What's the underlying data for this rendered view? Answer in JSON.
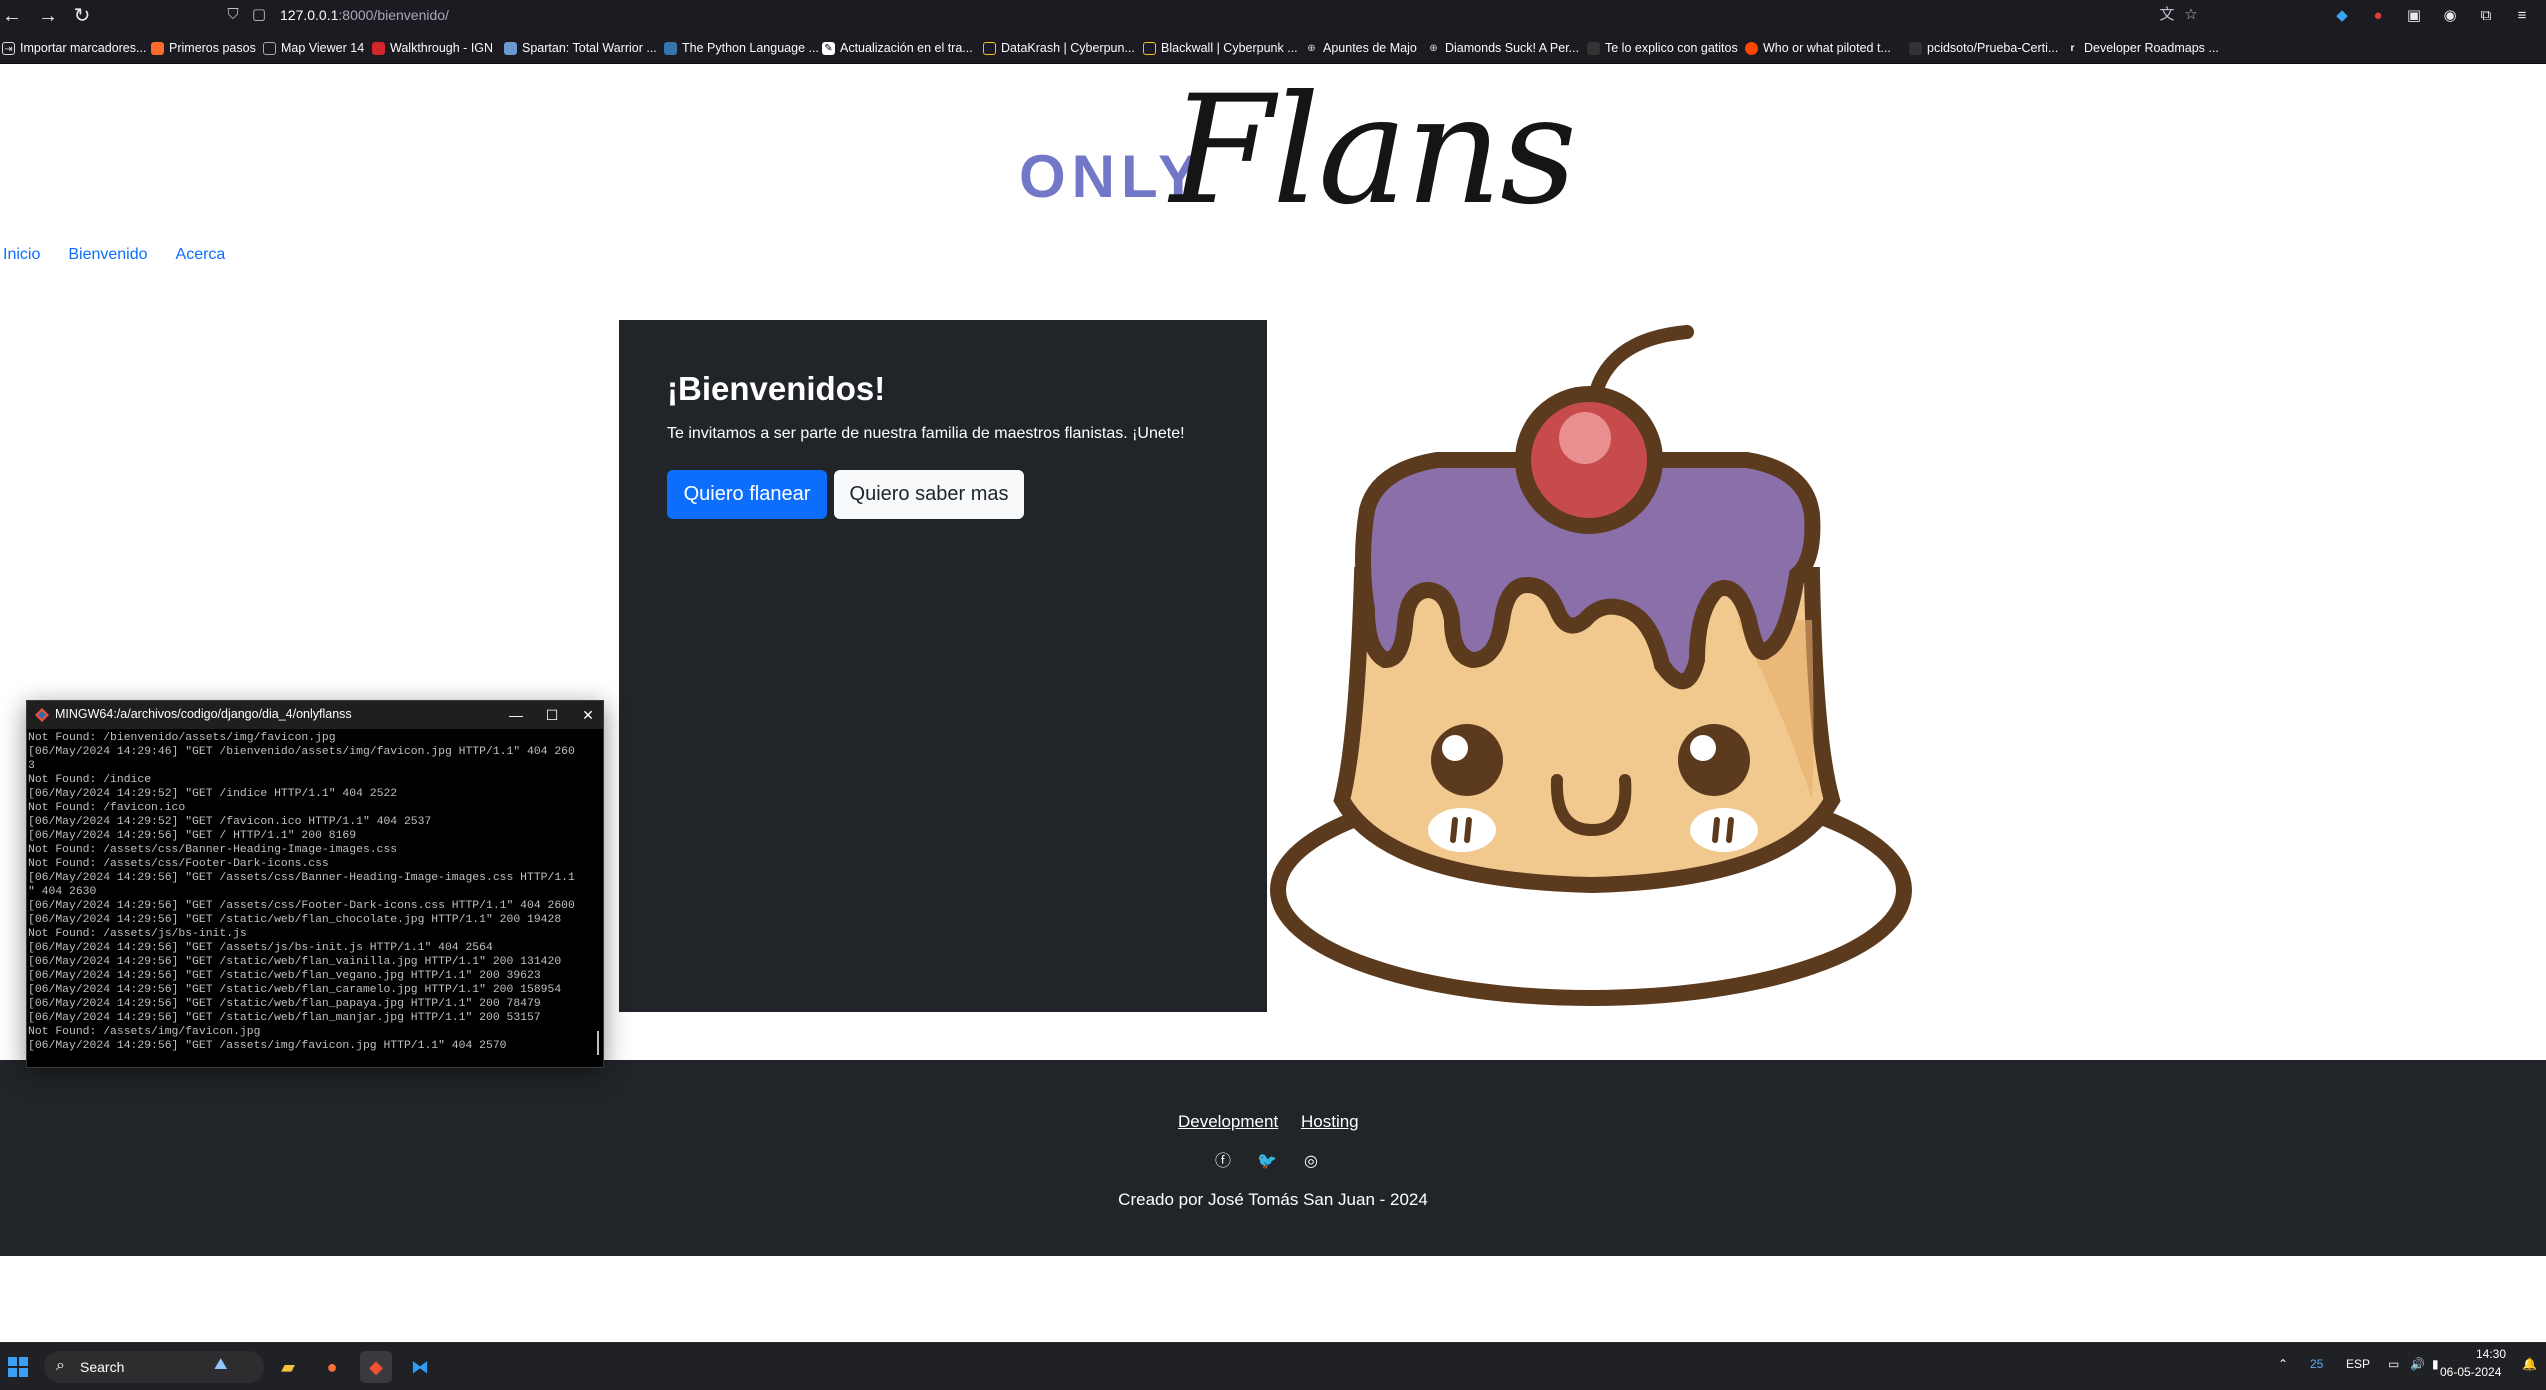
{
  "browser": {
    "url_host": "127.0.0.1",
    "url_path": ":8000/bienvenido/",
    "bookmarks": [
      "Importar marcadores...",
      "Primeros pasos",
      "Map Viewer 14",
      "Walkthrough - IGN",
      "Spartan: Total Warrior ...",
      "The Python Language ...",
      "Actualización en el tra...",
      "DataKrash | Cyberpun...",
      "Blackwall | Cyberpunk ...",
      "Apuntes de Majo",
      "Diamonds Suck! A Per...",
      "Te lo explico con gatitos",
      "Who or what piloted t...",
      "pcidsoto/Prueba-Certi...",
      "Developer Roadmaps ..."
    ]
  },
  "site": {
    "brand_small": "ONLY",
    "brand_script": "Flans",
    "nav": [
      "Inicio",
      "Bienvenido",
      "Acerca"
    ],
    "hero": {
      "title": "¡Bienvenidos!",
      "text": "Te invitamos a ser parte de nuestra familia de maestros flanistas. ¡Unete!",
      "btn_primary": "Quiero flanear",
      "btn_secondary": "Quiero saber mas"
    },
    "footer": {
      "links": [
        "Development",
        "Hosting"
      ],
      "social_icons": [
        "facebook-icon",
        "twitter-icon",
        "instagram-icon"
      ],
      "credit": "Creado por José Tomás San Juan - 2024"
    }
  },
  "terminal": {
    "title": "MINGW64:/a/archivos/codigo/django/dia_4/onlyflanss",
    "lines": [
      "Not Found: /bienvenido/assets/img/favicon.jpg",
      "[06/May/2024 14:29:46] \"GET /bienvenido/assets/img/favicon.jpg HTTP/1.1\" 404 260",
      "3",
      "Not Found: /indice",
      "[06/May/2024 14:29:52] \"GET /indice HTTP/1.1\" 404 2522",
      "Not Found: /favicon.ico",
      "[06/May/2024 14:29:52] \"GET /favicon.ico HTTP/1.1\" 404 2537",
      "[06/May/2024 14:29:56] \"GET / HTTP/1.1\" 200 8169",
      "Not Found: /assets/css/Banner-Heading-Image-images.css",
      "Not Found: /assets/css/Footer-Dark-icons.css",
      "[06/May/2024 14:29:56] \"GET /assets/css/Banner-Heading-Image-images.css HTTP/1.1",
      "\" 404 2630",
      "[06/May/2024 14:29:56] \"GET /assets/css/Footer-Dark-icons.css HTTP/1.1\" 404 2600",
      "[06/May/2024 14:29:56] \"GET /static/web/flan_chocolate.jpg HTTP/1.1\" 200 19428",
      "Not Found: /assets/js/bs-init.js",
      "[06/May/2024 14:29:56] \"GET /assets/js/bs-init.js HTTP/1.1\" 404 2564",
      "[06/May/2024 14:29:56] \"GET /static/web/flan_vainilla.jpg HTTP/1.1\" 200 131420",
      "[06/May/2024 14:29:56] \"GET /static/web/flan_vegano.jpg HTTP/1.1\" 200 39623",
      "[06/May/2024 14:29:56] \"GET /static/web/flan_caramelo.jpg HTTP/1.1\" 200 158954",
      "[06/May/2024 14:29:56] \"GET /static/web/flan_papaya.jpg HTTP/1.1\" 200 78479",
      "[06/May/2024 14:29:56] \"GET /static/web/flan_manjar.jpg HTTP/1.1\" 200 53157",
      "Not Found: /assets/img/favicon.jpg",
      "[06/May/2024 14:29:56] \"GET /assets/img/favicon.jpg HTTP/1.1\" 404 2570"
    ]
  },
  "taskbar": {
    "search_label": "Search",
    "weather_temp": "25",
    "lang": "ESP",
    "time": "14:30",
    "date": "06-05-2024"
  },
  "colors": {
    "brand_purple": "#7277c7",
    "primary_button": "#0d6efd",
    "dark_panel": "#212529"
  }
}
